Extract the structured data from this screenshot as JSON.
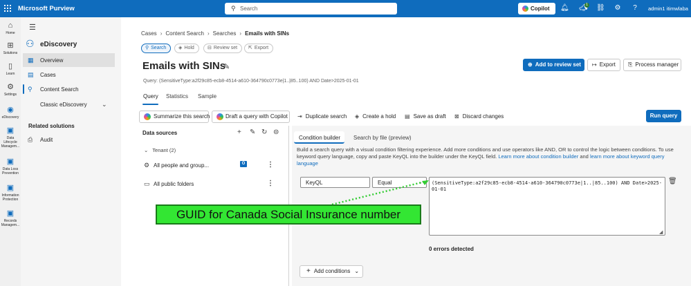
{
  "app": {
    "brand": "Microsoft Purview"
  },
  "topbar": {
    "search_placeholder": "Search",
    "copilot_label": "Copilot",
    "notification_count": "1",
    "user": "admin1 itimwlaba",
    "icons": [
      "waffle-icon",
      "search-icon",
      "bell-icon",
      "megaphone-icon",
      "link-icon",
      "gear-icon",
      "help-icon"
    ]
  },
  "rail": {
    "items": [
      {
        "label": "Home",
        "icon": "home-icon"
      },
      {
        "label": "Solutions",
        "icon": "solutions-icon"
      },
      {
        "label": "Learn",
        "icon": "learn-icon"
      },
      {
        "label": "Settings",
        "icon": "settings-icon"
      },
      {
        "label": "eDiscovery",
        "icon": "ediscovery-icon"
      },
      {
        "label": "Data Lifecycle Managem...",
        "icon": "data-lifecycle-icon"
      },
      {
        "label": "Data Loss Prevention",
        "icon": "dlp-icon"
      },
      {
        "label": "Information Protection",
        "icon": "info-protection-icon"
      },
      {
        "label": "Records Managem...",
        "icon": "records-icon"
      }
    ]
  },
  "nav": {
    "title": "eDiscovery",
    "overview": "Overview",
    "cases": "Cases",
    "content_search": "Content Search",
    "classic": "Classic eDiscovery",
    "related_header": "Related solutions",
    "audit": "Audit"
  },
  "breadcrumb": {
    "items": [
      "Cases",
      "Content Search",
      "Searches"
    ],
    "current": "Emails with SINs"
  },
  "pills": {
    "search": "Search",
    "hold": "Hold",
    "review": "Review set",
    "export": "Export"
  },
  "page": {
    "title": "Emails with SINs",
    "query": "Query: (SensitiveType:a2f29c85-ecb8-4514-a610-364790c0773e|1..|85..100) AND Date>2025-01-01"
  },
  "actions": {
    "add_review": "Add to review set",
    "export": "Export",
    "process_manager": "Process manager"
  },
  "tabs": [
    "Query",
    "Statistics",
    "Sample"
  ],
  "toolbar": {
    "summarize": "Summarize this search",
    "draft": "Draft a query with Copilot",
    "duplicate": "Duplicate search",
    "create_hold": "Create a hold",
    "save_draft": "Save as draft",
    "discard": "Discard changes",
    "run": "Run query"
  },
  "datasources": {
    "title": "Data sources",
    "tenant": "Tenant (2)",
    "rows": [
      "All people and group...",
      "All public folders"
    ]
  },
  "builder": {
    "tab_active": "Condition builder",
    "tab_other": "Search by file (preview)",
    "desc": "Build a search query with a visual condition filtering experience. Add more conditions and use operators like AND, OR to control the logic between conditions. To use keyword query language, copy and paste KeyQL into the builder under the KeyQL field.",
    "link1": "Learn more about condition builder",
    "and": "and",
    "link2": "learn more about keyword query language",
    "field": "KeyQL",
    "operator": "Equal",
    "value": "(SensitiveType:a2f29c85-ecb8-4514-a610-364790c0773e|1..|85..100) AND Date>2025-01-01",
    "errors": "0 errors detected",
    "add_conditions": "Add conditions"
  },
  "annotation": {
    "text": "GUID for Canada Social Insurance number",
    "color": "#33e633"
  },
  "colors": {
    "accent": "#0f6cbd",
    "annotation": "#33e633"
  }
}
